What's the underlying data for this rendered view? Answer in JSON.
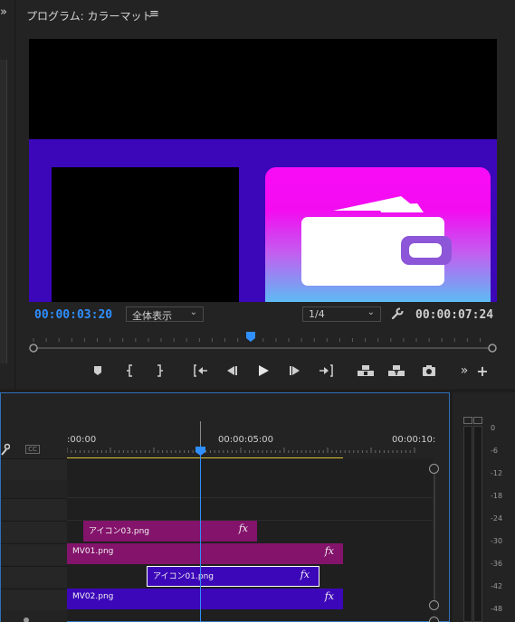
{
  "left_panel": {
    "collapse_glyph": "»"
  },
  "monitor": {
    "title": "プログラム: カラーマット",
    "menu_glyph": "≡",
    "timecode_current": "00:00:03:20",
    "zoom_select": "全体表示",
    "resolution_select": "1/4",
    "timecode_duration": "00:00:07:24",
    "accent": "#2f8fff",
    "controls": {
      "add_marker": "add-marker-icon",
      "mark_in": "mark-in-icon",
      "mark_out": "mark-out-icon",
      "go_to_in": "go-to-in-icon",
      "step_back": "step-back-icon",
      "play": "play-icon",
      "step_forward": "step-forward-icon",
      "go_to_out": "go-to-out-icon",
      "lift": "lift-icon",
      "extract": "extract-icon",
      "export_frame": "camera-icon",
      "more": "»",
      "add": "+"
    }
  },
  "timeline": {
    "ruler_labels": [
      ":00:00",
      "00:00:05:00",
      "00:00:10:"
    ],
    "playhead_fraction": 0.475,
    "clips": [
      {
        "label": "アイコン03.png",
        "fx": "fx",
        "color": "#84136b"
      },
      {
        "label": "MV01.png",
        "fx": "fx",
        "color": "#84136b"
      },
      {
        "label": "アイコン01.png",
        "fx": "fx",
        "color": "#3c07b9"
      },
      {
        "label": "MV02.png",
        "fx": "fx",
        "color": "#3c07b9"
      }
    ],
    "cc_label": "CC"
  },
  "audio_meter": {
    "labels": [
      "0",
      "-6",
      "-12",
      "-18",
      "-24",
      "-30",
      "-36",
      "-42",
      "-48"
    ]
  }
}
